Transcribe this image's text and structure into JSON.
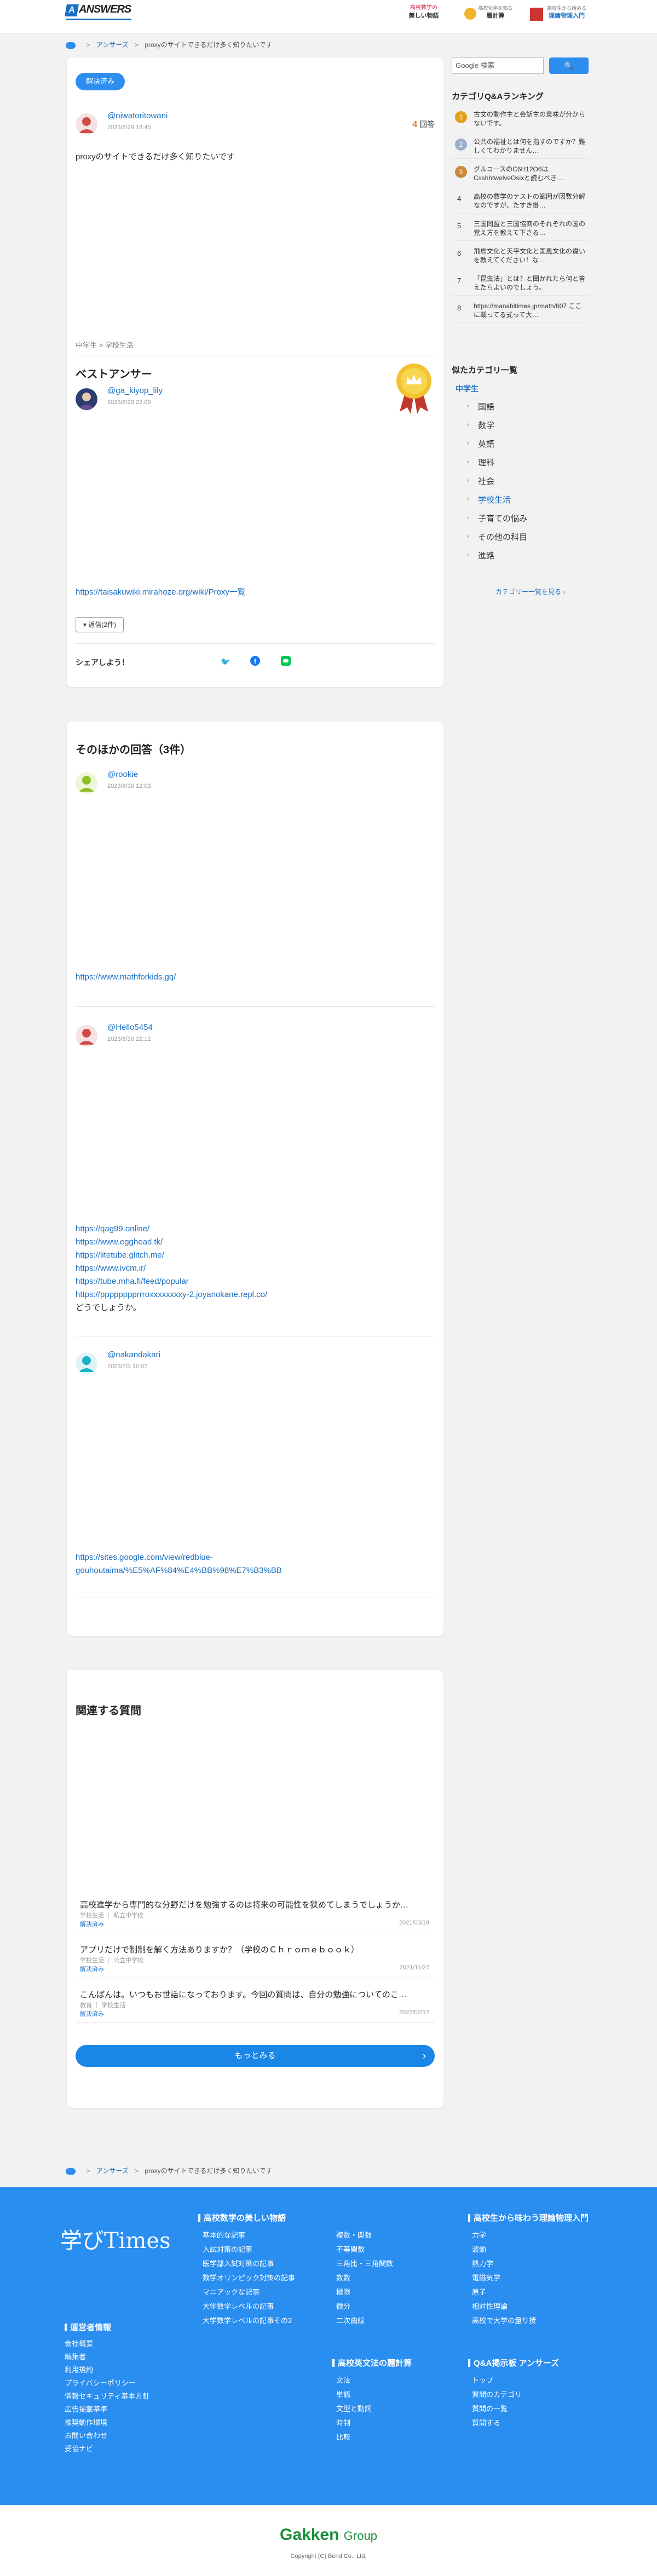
{
  "header": {
    "logo_word": "ANSWERS",
    "logo_letter": "A",
    "ads": [
      {
        "line1": "高校数学の",
        "line2": "美しい物語"
      },
      {
        "line1": "高校化学を知る",
        "line2": "麗計算"
      },
      {
        "line1": "高校生から始める",
        "line2": "理論物理入門"
      }
    ]
  },
  "breadcrumb": {
    "items": [
      "アンサーズ",
      "proxyのサイトできるだけ多く知りたいです"
    ]
  },
  "question": {
    "status": "解決済み",
    "user": "@niwatoritowani",
    "date": "2023/6/29 18:45",
    "answer_count": "4",
    "answer_count_label": "回答",
    "text": "proxyのサイトできるだけ多く知りたいです",
    "categories": [
      "中学生",
      "学校生活"
    ],
    "best_answer_title": "ベストアンサー",
    "best_user": "@ga_kiyop_lily",
    "best_date": "2023/6/29 22:09",
    "best_link": "https://taisakuwiki.mirahoze.org/wiki/Proxy一覧",
    "reply_btn": "返信(2件)",
    "share_label": "シェアしよう！"
  },
  "other_answers": {
    "title": "そのほかの回答（3件）",
    "answers": [
      {
        "user": "@rookie",
        "date": "2023/6/30 12:03",
        "lines": [
          "https://www.mathforkids.gq/"
        ]
      },
      {
        "user": "@Hello5454",
        "date": "2023/6/30 22:12",
        "lines": [
          "https://qag99.online/",
          "https://www.egghead.tk/",
          "https://litetube.glitch.me/",
          "https://www.ivcm.ir/",
          "https://tube.mha.fi/feed/popular",
          "https://pppppppprrroxxxxxxxxy-2.joyanokane.repl.co/",
          "どうでしょうか。"
        ]
      },
      {
        "user": "@nakandakari",
        "date": "2023/7/3 10:07",
        "lines": [
          "https://sites.google.com/view/redblue-",
          "gouhoutaima/%E5%AF%84%E4%BB%98%E7%B3%BB"
        ]
      }
    ]
  },
  "related": {
    "title": "関連する質問",
    "items": [
      {
        "title": "高校進学から専門的な分野だけを勉強するのは将来の可能性を狭めてしまうでしょうか…",
        "meta": "学校生活 ｜ 私立中学校",
        "status": "解決済み",
        "date": "2021/03/19"
      },
      {
        "title": "アプリだけで制制を解く方法ありますか？（学校のＣｈｒｏｍｅｂｏｏｋ）",
        "meta": "学校生活 ｜ 公立中学校",
        "status": "解決済み",
        "date": "2021/11/27"
      },
      {
        "title": "こんばんは。いつもお世話になっております。今回の質問は、自分の勉強についてのこ…",
        "meta": "教育 ｜ 学校生活",
        "status": "解決済み",
        "date": "2022/02/12"
      }
    ],
    "more_label": "もっとみる"
  },
  "sidebar": {
    "search_placeholder": "Google 検索",
    "search_btn": "🔍",
    "ranking_title": "カテゴリQ&Aランキング",
    "ranking": [
      {
        "num": "1",
        "text": "古文の動作主と会話主の意味が分からないです。",
        "color": "#e2a11a"
      },
      {
        "num": "2",
        "text": "公共の福祉とは何を指すのですか？難しくてわかりません…",
        "color": "#9ab0c8"
      },
      {
        "num": "3",
        "text": "グルコースのC6H12O6はCsshhtwelveOsixと読むべき…",
        "color": "#c98a3a"
      },
      {
        "num": "4",
        "text": "高校の数学のテストの範囲が因数分解なのですが、たすき掛…",
        "color": ""
      },
      {
        "num": "5",
        "text": "三国同盟と三国協商のそれぞれの国の覚え方を教えて下さる…",
        "color": ""
      },
      {
        "num": "6",
        "text": "飛鳥文化と天平文化と国風文化の違いを教えてください！な…",
        "color": ""
      },
      {
        "num": "7",
        "text": "「昆虫法」とは？と聞かれたら何と答えたらよいのでしょう。",
        "color": ""
      },
      {
        "num": "8",
        "text": "https://manabitimes.jp/math/607 ここに載ってる式って大…",
        "color": ""
      }
    ],
    "category_title": "似たカテゴリ一覧",
    "category_parent": "中学生",
    "categories": [
      "国語",
      "数学",
      "英語",
      "理科",
      "社会",
      "学校生活",
      "子育ての悩み",
      "その他の科目",
      "進路"
    ],
    "category_active": "学校生活",
    "category_more": "カテゴリー一覧を見る"
  },
  "footer": {
    "logo": "学びTimes",
    "col1_title": "運営者情報",
    "col1": [
      "会社概要",
      "編集者",
      "利用規約",
      "プライバシーポリシー",
      "情報セキュリティ基本方針",
      "広告掲載基準",
      "推奨動作環境",
      "お問い合わせ",
      "妥協ナビ"
    ],
    "col2_title": "高校数学の美しい物語",
    "col2a": [
      "基本的な記事",
      "入試対策の記事",
      "医学部入試対策の記事",
      "数学オリンピック対策の記事",
      "マニアックな記事",
      "大学数学レベルの記事",
      "大学数学レベルの記事その2"
    ],
    "col2b": [
      "複数・関数",
      "不等関数",
      "三角比・三角関数",
      "数数",
      "極限",
      "微分",
      "二次曲線"
    ],
    "col3_title": "高校英文法の麗計算",
    "col3": [
      "文法",
      "単語",
      "文型と動詞",
      "時制",
      "比較"
    ],
    "col4_title": "高校生から味わう理論物理入門",
    "col4": [
      "力学",
      "波動",
      "熱力学",
      "電磁気学",
      "原子",
      "相対性理論",
      "高校で大学の量り授"
    ],
    "col5_title": "Q&A掲示板 アンサーズ",
    "col5": [
      "トップ",
      "質問のカテゴリ",
      "質問の一覧",
      "質問する"
    ],
    "brand": "Gakken",
    "brand_suffix": "Group",
    "copyright": "Copyright (C) Bend Co., Ltd."
  }
}
